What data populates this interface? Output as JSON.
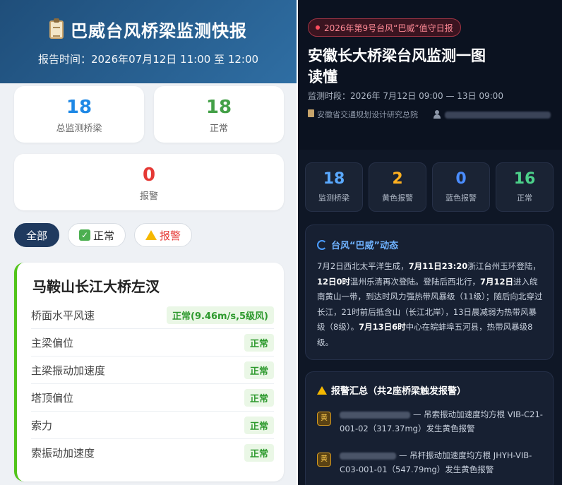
{
  "left": {
    "title": "巴威台风桥梁监测快报",
    "report_time": "报告时间：2026年07月12日 11:00 至 12:00",
    "stats": {
      "total": {
        "value": "18",
        "label": "总监测桥梁",
        "color": "#1e88e5"
      },
      "normal": {
        "value": "18",
        "label": "正常",
        "color": "#43a047"
      },
      "alarm": {
        "value": "0",
        "label": "报警",
        "color": "#e53935"
      }
    },
    "filters": {
      "all": "全部",
      "normal": "正常",
      "alarm": "报警"
    },
    "bridge": {
      "name": "马鞍山长江大桥左汊",
      "metrics": [
        {
          "name": "桥面水平风速",
          "value": "正常(9.46m/s,5级风)"
        },
        {
          "name": "主梁偏位",
          "value": "正常"
        },
        {
          "name": "主梁振动加速度",
          "value": "正常"
        },
        {
          "name": "塔顶偏位",
          "value": "正常"
        },
        {
          "name": "索力",
          "value": "正常"
        },
        {
          "name": "索振动加速度",
          "value": "正常"
        }
      ]
    }
  },
  "right": {
    "badge": "2026年第9号台风“巴威”值守日报",
    "title": "安徽长大桥梁台风监测一图读懂",
    "period": "监测时段：2026年 7月12日 09:00 — 13日 09:00",
    "org": "安徽省交通规划设计研究总院",
    "stats": [
      {
        "value": "18",
        "label": "监测桥梁",
        "color": "#5aa9ff"
      },
      {
        "value": "2",
        "label": "黄色报警",
        "color": "#ffb020"
      },
      {
        "value": "0",
        "label": "蓝色报警",
        "color": "#4a8dff"
      },
      {
        "value": "16",
        "label": "正常",
        "color": "#4cd18a"
      }
    ],
    "typhoon": {
      "heading": "台风“巴威”动态",
      "p1": "7月2日西北太平洋生成，",
      "b1": "7月11日23:20",
      "p2": "浙江台州玉环登陆，",
      "b2": "12日0时",
      "p3": "温州乐清再次登陆。登陆后西北行，",
      "b3": "7月12日",
      "p4": "进入皖南黄山一带，到达时风力强热带风暴级（11级）；随后向北穿过长江，21时前后抵含山（长江北岸），13日晨减弱为热带风暴级（8级）。",
      "b4": "7月13日6时",
      "p5": "中心在皖蚌埠五河县，热带风暴级8级。"
    },
    "alarm": {
      "heading": "报警汇总（共2座桥梁触发报警）",
      "tag": "黄",
      "items": [
        "— 吊索振动加速度均方根 VIB-C21-001-02（317.37mg）发生黄色报警",
        "— 吊杆振动加速度均方根 JHYH-VIB-C03-001-01（547.79mg）发生黄色报警"
      ]
    }
  }
}
